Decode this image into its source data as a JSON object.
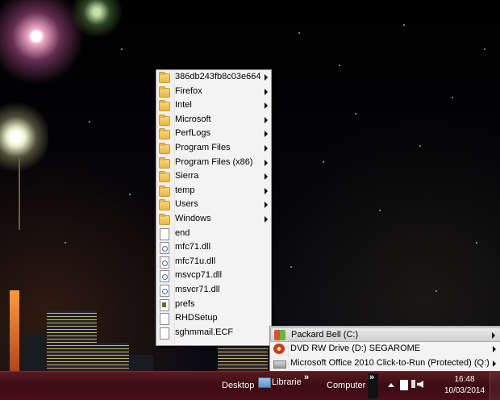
{
  "folder_menu": {
    "items": [
      {
        "label": "386db243fb8c03e664",
        "type": "folder",
        "submenu": true
      },
      {
        "label": "Firefox",
        "type": "folder",
        "submenu": true
      },
      {
        "label": "Intel",
        "type": "folder",
        "submenu": true
      },
      {
        "label": "Microsoft",
        "type": "folder",
        "submenu": true
      },
      {
        "label": "PerfLogs",
        "type": "folder",
        "submenu": true
      },
      {
        "label": "Program Files",
        "type": "folder",
        "submenu": true
      },
      {
        "label": "Program Files (x86)",
        "type": "folder",
        "submenu": true
      },
      {
        "label": "Sierra",
        "type": "folder",
        "submenu": true
      },
      {
        "label": "temp",
        "type": "folder",
        "submenu": true
      },
      {
        "label": "Users",
        "type": "folder",
        "submenu": true
      },
      {
        "label": "Windows",
        "type": "folder",
        "submenu": true
      },
      {
        "label": "end",
        "type": "file",
        "submenu": false
      },
      {
        "label": "mfc71.dll",
        "type": "dll",
        "submenu": false
      },
      {
        "label": "mfc71u.dll",
        "type": "dll",
        "submenu": false
      },
      {
        "label": "msvcp71.dll",
        "type": "dll",
        "submenu": false
      },
      {
        "label": "msvcr71.dll",
        "type": "dll",
        "submenu": false
      },
      {
        "label": "prefs",
        "type": "config",
        "submenu": false
      },
      {
        "label": "RHDSetup",
        "type": "file",
        "submenu": false
      },
      {
        "label": "sghmmail.ECF",
        "type": "file",
        "submenu": false
      }
    ]
  },
  "drive_menu": {
    "items": [
      {
        "label": "Packard Bell (C:)",
        "icon": "windows-drive-icon",
        "highlighted": true,
        "submenu": true
      },
      {
        "label": "DVD RW Drive (D:) SEGAROME",
        "icon": "dvd-drive-icon",
        "highlighted": false,
        "submenu": true
      },
      {
        "label": "Microsoft Office 2010 Click-to-Run (Protected) (Q:)",
        "icon": "hard-drive-icon",
        "highlighted": false,
        "submenu": true
      }
    ]
  },
  "taskbar": {
    "desktop_label": "Desktop",
    "libraries_label": "Librarie",
    "chevron": "»",
    "computer_label": "Computer",
    "time": "16:48",
    "date": "10/03/2014"
  },
  "colors": {
    "taskbar": "#4a0f16",
    "menu_bg": "#f3f3f3",
    "menu_highlight": "#cfcfcf"
  }
}
